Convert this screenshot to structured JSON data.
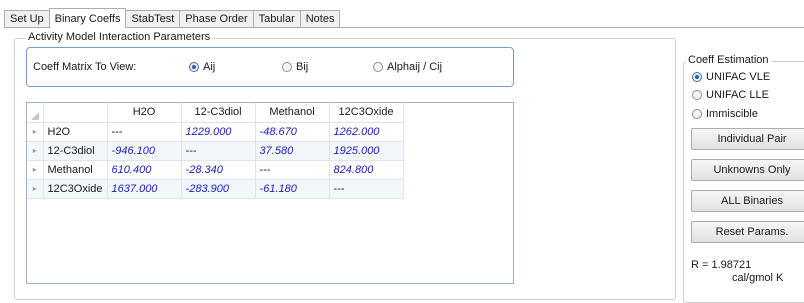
{
  "tabs": [
    "Set Up",
    "Binary Coeffs",
    "StabTest",
    "Phase Order",
    "Tabular",
    "Notes"
  ],
  "active_tab": "Binary Coeffs",
  "interaction_group": {
    "title": "Activity Model Interaction Parameters",
    "matrix_label": "Coeff Matrix To View:",
    "options": [
      {
        "label": "Aij",
        "selected": true
      },
      {
        "label": "Bij",
        "selected": false
      },
      {
        "label": "Alphaij / Cij",
        "selected": false
      }
    ]
  },
  "grid": {
    "columns": [
      "H2O",
      "12-C3diol",
      "Methanol",
      "12C3Oxide"
    ],
    "rows": [
      {
        "name": "H2O",
        "cells": [
          "---",
          "1229.000",
          "-48.670",
          "1262.000"
        ]
      },
      {
        "name": "12-C3diol",
        "cells": [
          "-946.100",
          "---",
          "37.580",
          "1925.000"
        ]
      },
      {
        "name": "Methanol",
        "cells": [
          "610.400",
          "-28.340",
          "---",
          "824.800"
        ]
      },
      {
        "name": "12C3Oxide",
        "cells": [
          "1637.000",
          "-283.900",
          "-61.180",
          "---"
        ]
      }
    ]
  },
  "coeff_estimation": {
    "title": "Coeff Estimation",
    "options": [
      {
        "label": "UNIFAC VLE",
        "selected": true
      },
      {
        "label": "UNIFAC LLE",
        "selected": false
      },
      {
        "label": "Immiscible",
        "selected": false
      }
    ],
    "buttons": [
      "Individual Pair",
      "Unknowns Only",
      "ALL Binaries",
      "Reset Params."
    ],
    "r_value": "R = 1.98721",
    "r_units": "cal/gmol K"
  }
}
